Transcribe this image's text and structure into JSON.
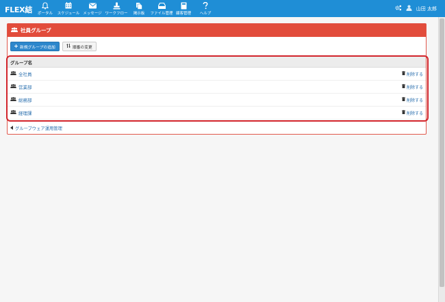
{
  "app": {
    "brand": "FLEX結"
  },
  "nav": [
    {
      "label": "ポータル",
      "icon": "bell-icon"
    },
    {
      "label": "スケジュール",
      "icon": "calendar-icon"
    },
    {
      "label": "メッセージ",
      "icon": "envelope-icon"
    },
    {
      "label": "ワークフロー",
      "icon": "stamp-icon"
    },
    {
      "label": "掲示板",
      "icon": "documents-icon"
    },
    {
      "label": "ファイル管理",
      "icon": "hdd-icon"
    },
    {
      "label": "顧客管理",
      "icon": "book-icon"
    },
    {
      "label": "ヘルプ",
      "icon": "question-icon"
    }
  ],
  "user": {
    "name": "山田 太郎"
  },
  "panel": {
    "title": "社員グループ",
    "add_button": "新規グループの追加",
    "order_button": "順番の変更",
    "column_header": "グループ名",
    "rows": [
      {
        "name": "全社員",
        "action": "削除する"
      },
      {
        "name": "営業部",
        "action": "削除する"
      },
      {
        "name": "総務部",
        "action": "削除する"
      },
      {
        "name": "経理課",
        "action": "削除する"
      }
    ],
    "footer_link": "グループウェア運用管理"
  },
  "colors": {
    "topbar": "#1f8ed6",
    "panel_header": "#e24c3b",
    "link": "#2a6fae",
    "highlight": "#d2232a"
  }
}
